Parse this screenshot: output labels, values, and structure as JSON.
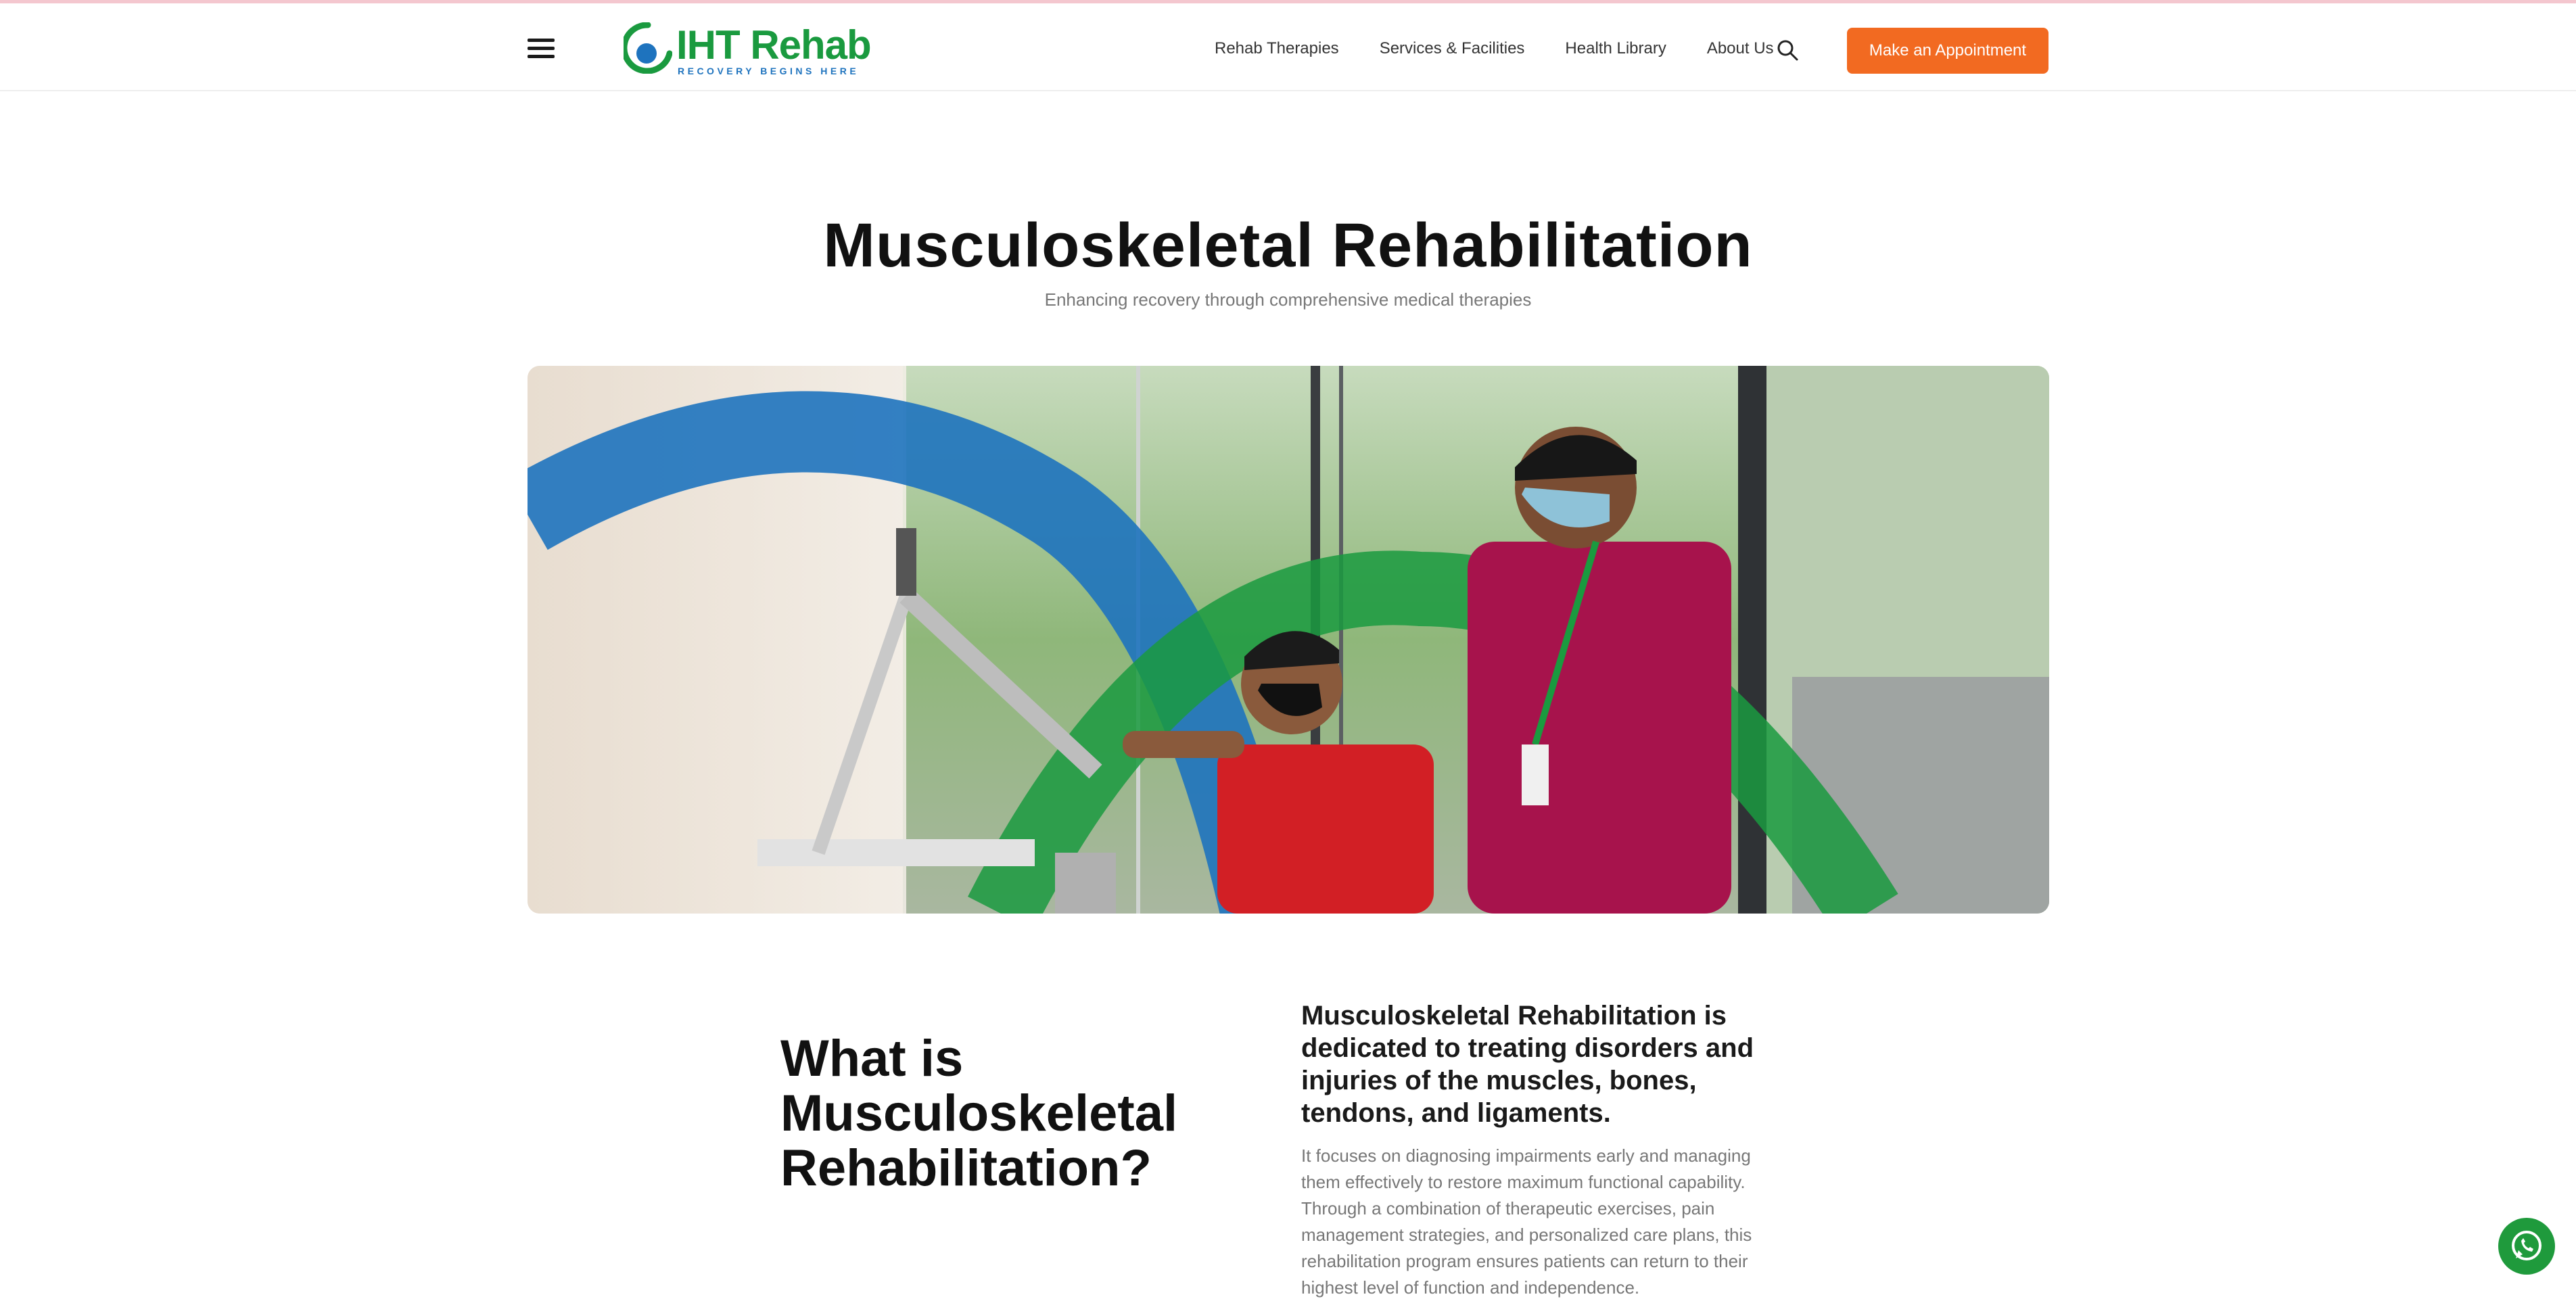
{
  "header": {
    "logo_text": "IHT Rehab",
    "logo_tagline": "RECOVERY BEGINS HERE",
    "nav": [
      {
        "label": "Rehab Therapies"
      },
      {
        "label": "Services & Facilities"
      },
      {
        "label": "Health Library"
      },
      {
        "label": "About Us"
      }
    ],
    "cta_label": "Make an Appointment"
  },
  "hero": {
    "title": "Musculoskeletal Rehabilitation",
    "subtitle": "Enhancing recovery through comprehensive medical therapies"
  },
  "section": {
    "heading": "What is Musculoskeletal Rehabilitation?",
    "intro": "Musculoskeletal Rehabilitation is dedicated to treating disorders and injuries of the muscles, bones, tendons, and ligaments.",
    "body": "It focuses on diagnosing impairments early and managing them effectively to restore maximum functional capability. Through a combination of therapeutic exercises, pain management strategies, and personalized care plans, this rehabilitation program ensures patients can return to their highest level of function and independence."
  },
  "icons": {
    "menu": "hamburger-menu-icon",
    "search": "search-icon",
    "whatsapp": "whatsapp-icon"
  },
  "colors": {
    "brand_green": "#1a9a3f",
    "brand_blue": "#1e73be",
    "cta_orange": "#f26a21"
  }
}
